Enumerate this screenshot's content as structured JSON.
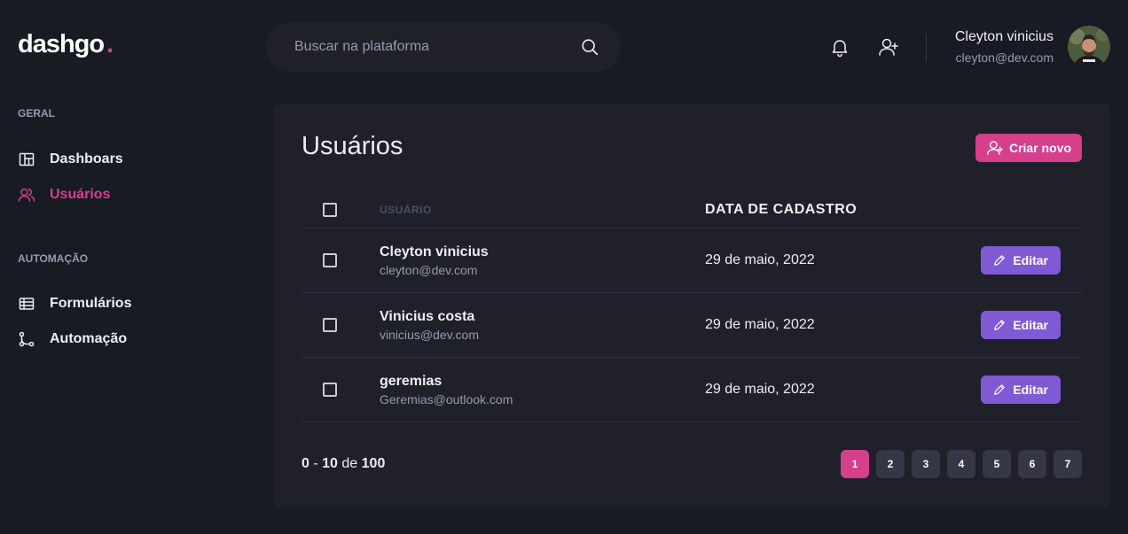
{
  "brand": {
    "name": "dashgo",
    "dot": "."
  },
  "search": {
    "placeholder": "Buscar na plataforma"
  },
  "user": {
    "name": "Cleyton vinicius",
    "email": "cleyton@dev.com"
  },
  "sidebar": {
    "sections": [
      {
        "title": "GERAL",
        "items": [
          {
            "label": "Dashboars",
            "icon": "dashboard-icon",
            "active": false
          },
          {
            "label": "Usuários",
            "icon": "users-icon",
            "active": true
          }
        ]
      },
      {
        "title": "AUTOMAÇÃO",
        "items": [
          {
            "label": "Formulários",
            "icon": "forms-icon",
            "active": false
          },
          {
            "label": "Automação",
            "icon": "automation-icon",
            "active": false
          }
        ]
      }
    ]
  },
  "main": {
    "title": "Usuários",
    "new_button": "Criar novo",
    "table": {
      "headers": {
        "user": "USUÁRIO",
        "date": "DATA DE CADASTRO"
      },
      "rows": [
        {
          "name": "Cleyton vinicius",
          "email": "cleyton@dev.com",
          "date": "29 de maio, 2022",
          "action": "Editar"
        },
        {
          "name": "Vinicius costa",
          "email": "vinicius@dev.com",
          "date": "29 de maio, 2022",
          "action": "Editar"
        },
        {
          "name": "geremias",
          "email": "Geremias@outlook.com",
          "date": "29 de maio, 2022",
          "action": "Editar"
        }
      ]
    },
    "pagination": {
      "start": "0",
      "end": "10",
      "of": "de",
      "total": "100",
      "sep": "-",
      "pages": [
        "1",
        "2",
        "3",
        "4",
        "5",
        "6",
        "7"
      ],
      "current": "1"
    }
  },
  "colors": {
    "accent": "#d53f8c",
    "edit": "#805ad5",
    "background": "#181b23",
    "card": "#1f2029"
  }
}
